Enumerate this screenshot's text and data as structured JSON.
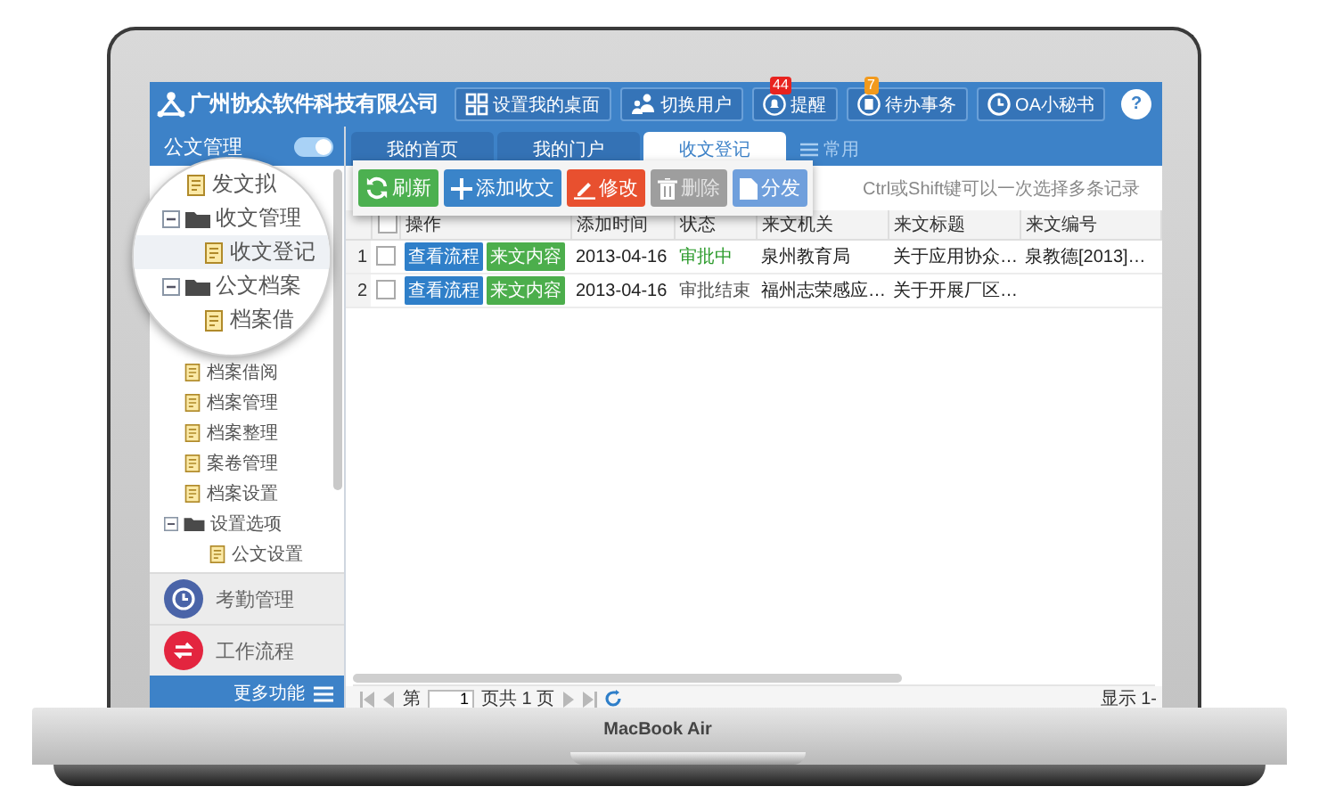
{
  "laptop": {
    "model": "MacBook Air"
  },
  "header": {
    "company": "广州协众软件科技有限公司",
    "buttons": [
      {
        "kind": "desktop",
        "label": "设置我的桌面"
      },
      {
        "kind": "user",
        "label": "切换用户"
      },
      {
        "kind": "bell",
        "label": "提醒",
        "badge": {
          "text": "44",
          "color": "#e8231f"
        }
      },
      {
        "kind": "todo",
        "label": "待办事务",
        "badge": {
          "text": "7",
          "color": "#f29a1d"
        }
      },
      {
        "kind": "clock",
        "label": "OA小秘书"
      },
      {
        "kind": "help",
        "label": "?"
      }
    ]
  },
  "sidebar": {
    "title": "公文管理",
    "toggle_on": true,
    "magnifier": [
      {
        "label": "发文拟",
        "selected": false
      },
      {
        "label": "收文管理",
        "expanded": true,
        "children": [
          {
            "label": "收文登记",
            "selected": true
          }
        ]
      },
      {
        "label": "公文档案",
        "expanded": true,
        "children": [
          {
            "label": "档案借",
            "selected": false
          }
        ]
      }
    ],
    "tree": [
      {
        "label": "档案借阅",
        "selected": false
      },
      {
        "label": "档案管理",
        "selected": false
      },
      {
        "label": "档案整理",
        "selected": false
      },
      {
        "label": "案卷管理",
        "selected": false
      },
      {
        "label": "档案设置",
        "selected": false
      },
      {
        "label": "设置选项",
        "expanded": true,
        "children": [
          {
            "label": "公文设置",
            "selected": false
          }
        ]
      }
    ],
    "modules": [
      {
        "kind": "clock",
        "label": "考勤管理",
        "color": "#4a64a8"
      },
      {
        "kind": "flow",
        "label": "工作流程",
        "color": "#e3253f"
      }
    ],
    "more": "更多功能"
  },
  "tabs": [
    {
      "label": "我的首页",
      "selected": false
    },
    {
      "label": "我的门户",
      "selected": false
    },
    {
      "label": "收文登记",
      "selected": true
    }
  ],
  "favorites": "常用",
  "toolbar": [
    {
      "kind": "refresh",
      "label": "刷新",
      "color": "#4cb050",
      "disabled": false
    },
    {
      "kind": "add",
      "label": "添加收文",
      "color": "#3a84c9",
      "disabled": false
    },
    {
      "kind": "edit",
      "label": "修改",
      "color": "#e8502f",
      "disabled": false
    },
    {
      "kind": "delete",
      "label": "删除",
      "color": "#9e9e9e",
      "disabled": true
    },
    {
      "kind": "send",
      "label": "分发",
      "color": "#6f9fdc",
      "disabled": false
    }
  ],
  "hint": "Ctrl或Shift键可以一次选择多条记录",
  "table": {
    "all_checked": false,
    "columns": [
      "操作",
      "添加时间",
      "状态",
      "来文机关",
      "来文标题",
      "来文编号"
    ],
    "rows": [
      {
        "number": "1",
        "checked": false,
        "actions": [
          {
            "label": "查看流程",
            "color": "#2f7fc9"
          },
          {
            "label": "来文内容",
            "color": "#4cae4c"
          }
        ],
        "date": "2013-04-16",
        "status": {
          "text": "审批中",
          "color": "#2a9a2a"
        },
        "agency": "泉州教育局",
        "title": "关于应用协众…",
        "doc_no": "泉教德[2013]…"
      },
      {
        "number": "2",
        "checked": false,
        "actions": [
          {
            "label": "查看流程",
            "color": "#2f7fc9"
          },
          {
            "label": "来文内容",
            "color": "#4cae4c"
          }
        ],
        "date": "2013-04-16",
        "status": {
          "text": "审批结束",
          "color": "#555555"
        },
        "agency": "福州志荣感应…",
        "title": "关于开展厂区…"
      }
    ]
  },
  "pager": {
    "page_prefix": "第",
    "page": "1",
    "page_suffix": "页共 1 页",
    "display": "显示 1-"
  }
}
